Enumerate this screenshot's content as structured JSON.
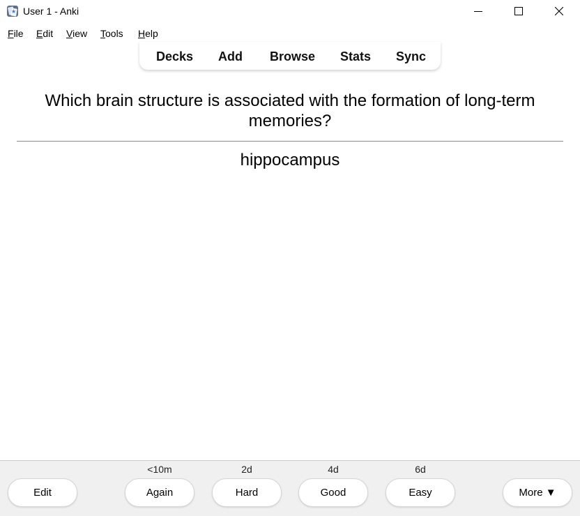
{
  "window": {
    "title": "User 1 - Anki",
    "app_icon": "anki-icon",
    "controls": [
      "minimize-icon",
      "maximize-icon",
      "close-icon"
    ]
  },
  "menu": {
    "items": [
      {
        "mnemonic": "F",
        "rest": "ile"
      },
      {
        "mnemonic": "E",
        "rest": "dit"
      },
      {
        "mnemonic": "V",
        "rest": "iew"
      },
      {
        "mnemonic": "T",
        "rest": "ools"
      },
      {
        "mnemonic": "H",
        "rest": "elp"
      }
    ]
  },
  "toolbar": {
    "links": [
      "Decks",
      "Add",
      "Browse",
      "Stats",
      "Sync"
    ]
  },
  "card": {
    "question": "Which brain structure is associated with the formation of long-term memories?",
    "answer": "hippocampus"
  },
  "bottom": {
    "edit_label": "Edit",
    "answers": [
      {
        "interval": "<10m",
        "label": "Again"
      },
      {
        "interval": "2d",
        "label": "Hard"
      },
      {
        "interval": "4d",
        "label": "Good"
      },
      {
        "interval": "6d",
        "label": "Easy"
      }
    ],
    "more_label": "More ▼"
  }
}
